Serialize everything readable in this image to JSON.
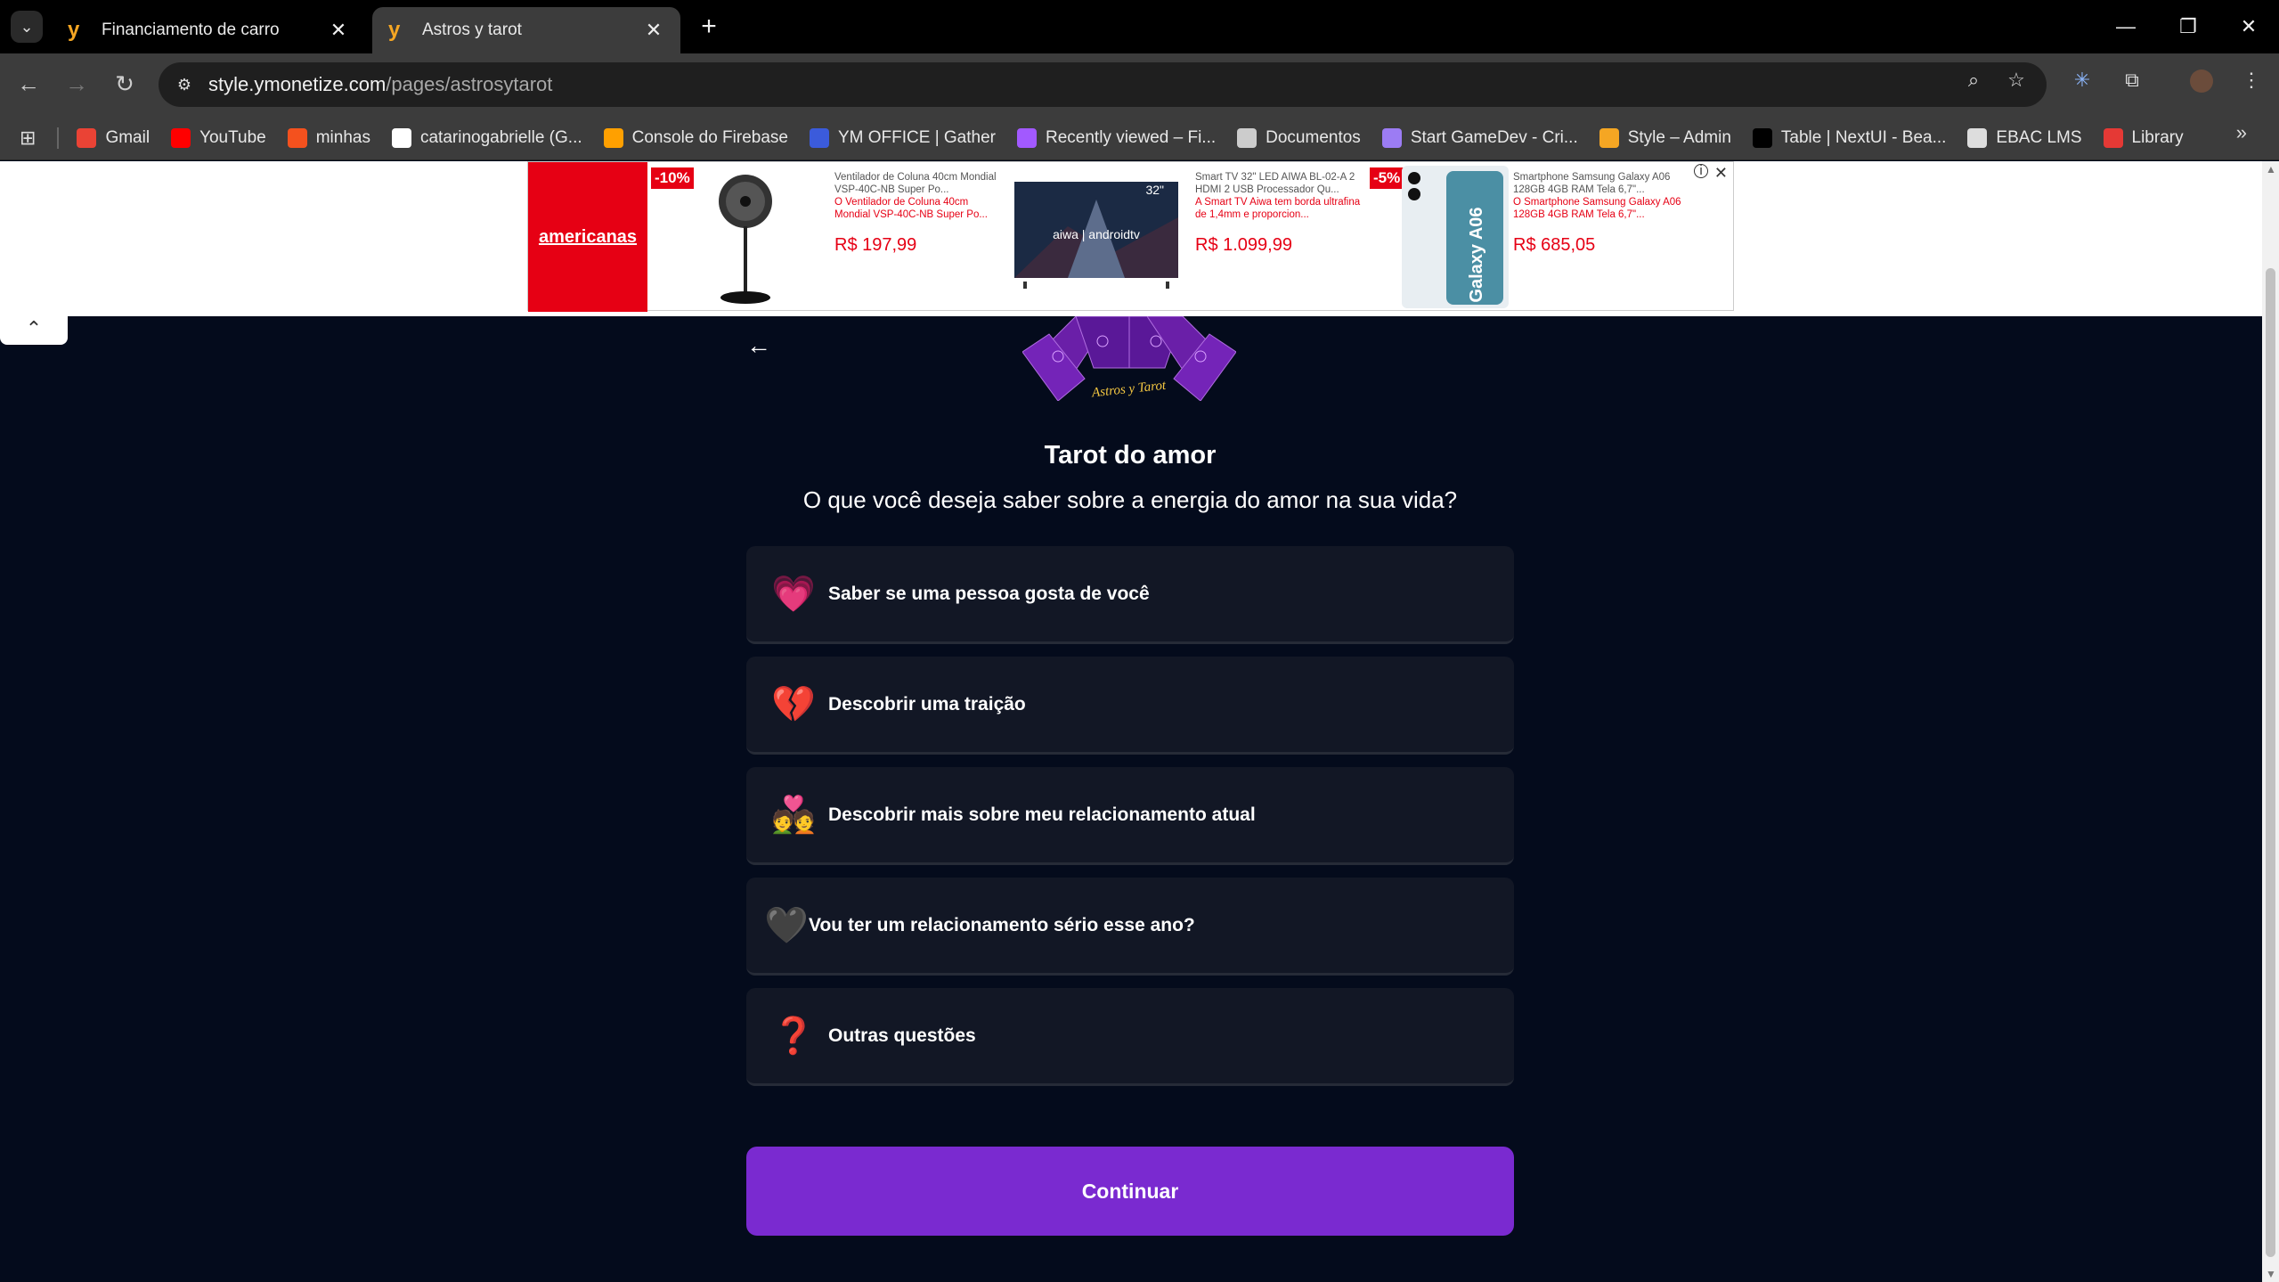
{
  "browser": {
    "tabs": [
      {
        "title": "Financiamento de carro",
        "active": false
      },
      {
        "title": "Astros y tarot",
        "active": true
      }
    ],
    "url_host": "style.ymonetize.com",
    "url_path": "/pages/astrosytarot",
    "bookmarks": [
      {
        "label": "Gmail",
        "icon": "gmail-icon",
        "color": "#ea4335"
      },
      {
        "label": "YouTube",
        "icon": "youtube-icon",
        "color": "#ff0000"
      },
      {
        "label": "minhas",
        "icon": "flame-icon",
        "color": "#f4511e"
      },
      {
        "label": "catarinogabrielle (G...",
        "icon": "github-icon",
        "color": "#ffffff"
      },
      {
        "label": "Console do Firebase",
        "icon": "firebase-icon",
        "color": "#ffa000"
      },
      {
        "label": "YM OFFICE | Gather",
        "icon": "gather-icon",
        "color": "#3b5bdb"
      },
      {
        "label": "Recently viewed – Fi...",
        "icon": "figma-icon",
        "color": "#a259ff"
      },
      {
        "label": "Documentos",
        "icon": "docs-icon",
        "color": "#cccccc"
      },
      {
        "label": "Start GameDev - Cri...",
        "icon": "rocket-icon",
        "color": "#9c7cf4"
      },
      {
        "label": "Style – Admin",
        "icon": "y-icon",
        "color": "#f5a623"
      },
      {
        "label": "Table | NextUI - Bea...",
        "icon": "nextui-icon",
        "color": "#000000"
      },
      {
        "label": "EBAC LMS",
        "icon": "ebac-icon",
        "color": "#dddddd"
      },
      {
        "label": "Library",
        "icon": "library-icon",
        "color": "#e53935"
      }
    ]
  },
  "ad": {
    "brand": "americanas",
    "items": [
      {
        "badge": "-10%",
        "title": "Ventilador de Coluna 40cm Mondial VSP-40C-NB Super Po...",
        "desc": "O Ventilador de Coluna 40cm Mondial VSP-40C-NB Super Po...",
        "price": "R$ 197,99"
      },
      {
        "badge": "",
        "title": "Smart TV 32\" LED AIWA BL-02-A 2 HDMI 2 USB Processador Qu...",
        "desc": "A Smart TV Aiwa tem borda ultrafina de 1,4mm e proporcion...",
        "price": "R$ 1.099,99",
        "tv_size": "32\"",
        "tv_brand": "aiwa | androidtv"
      },
      {
        "badge": "-5%",
        "title": "Smartphone Samsung Galaxy A06 128GB 4GB RAM Tela 6,7\"...",
        "desc": "O Smartphone Samsung Galaxy A06 128GB 4GB RAM Tela 6,7\"...",
        "price": "R$ 685,05",
        "phone_text": "Galaxy A06"
      }
    ]
  },
  "page": {
    "logo_text": "Astros y Tarot",
    "title": "Tarot do amor",
    "subtitle": "O que você deseja saber sobre a energia do amor na sua vida?",
    "options": [
      {
        "emoji": "💗",
        "label": "Saber se uma pessoa gosta de você"
      },
      {
        "emoji": "💔",
        "label": "Descobrir uma traição"
      },
      {
        "emoji": "💑",
        "label": "Descobrir mais sobre meu relacionamento atual"
      },
      {
        "emoji": "🖤",
        "label": "Vou ter um relacionamento sério esse ano?"
      },
      {
        "emoji": "❓",
        "label": "Outras questões"
      }
    ],
    "continue_label": "Continuar"
  },
  "colors": {
    "page_bg": "#040b1c",
    "option_bg": "#121725",
    "continue_bg": "#7a2ad0",
    "ad_red": "#e60014"
  }
}
